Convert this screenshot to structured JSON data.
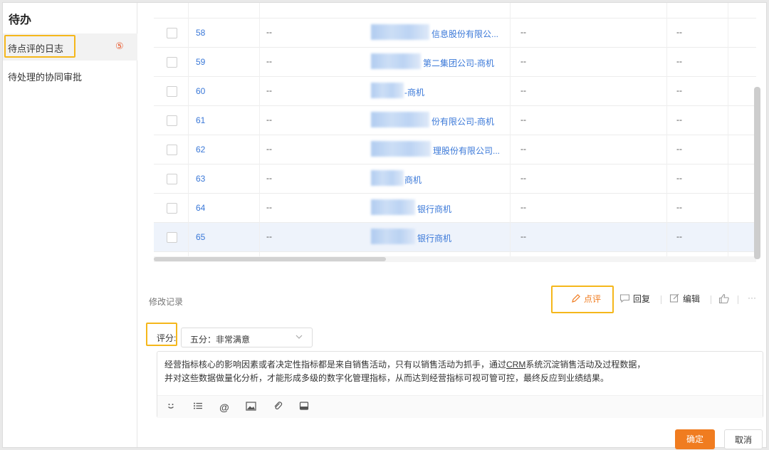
{
  "sidebar": {
    "title": "待办",
    "items": [
      {
        "label": "待点评的日志",
        "badge": "⑤"
      },
      {
        "label": "待处理的协同审批"
      }
    ]
  },
  "table": {
    "rows": [
      {
        "id": "58",
        "c1": "--",
        "org": "信息股份有限公...",
        "c3": "--",
        "c4": "--"
      },
      {
        "id": "59",
        "c1": "--",
        "org": "第二集团公司-商机",
        "c3": "--",
        "c4": "--"
      },
      {
        "id": "60",
        "c1": "--",
        "org": "-商机",
        "c3": "--",
        "c4": "--"
      },
      {
        "id": "61",
        "c1": "--",
        "org": "份有限公司-商机",
        "c3": "--",
        "c4": "--"
      },
      {
        "id": "62",
        "c1": "--",
        "org": "理股份有限公司...",
        "c3": "--",
        "c4": "--"
      },
      {
        "id": "63",
        "c1": "--",
        "org": "商机",
        "c3": "--",
        "c4": "--"
      },
      {
        "id": "64",
        "c1": "--",
        "org": "银行商机",
        "c3": "--",
        "c4": "--"
      },
      {
        "id": "65",
        "c1": "--",
        "org": "银行商机",
        "c3": "--",
        "c4": "--"
      }
    ]
  },
  "actions": {
    "modify_record": "修改记录",
    "review": "点评",
    "reply": "回复",
    "edit": "编辑",
    "more": "···"
  },
  "rating": {
    "label": "评分:",
    "value": "五分：非常满意"
  },
  "comment": {
    "line1_pre": "经营指标核心的影响因素或者决定性指标都是来自销售活动，只有以销售活动为抓手，通过",
    "line1_crm": "CRM",
    "line1_post": "系统沉淀销售活动及过程数据，",
    "line2": "并对这些数据做量化分析，才能形成多级的数字化管理指标，从而达到经营指标可视可管可控，最终反应到业绩结果。"
  },
  "buttons": {
    "ok": "确定",
    "cancel": "取消"
  },
  "colors": {
    "accent": "#f07c20",
    "link": "#3a78d8",
    "highlight": "#f5b71b",
    "badge": "#e8572a"
  }
}
